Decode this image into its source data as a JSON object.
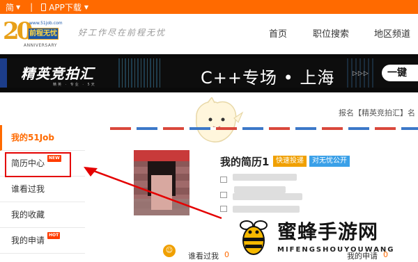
{
  "topbar": {
    "lang": "简",
    "app_download": "APP下载"
  },
  "logo": {
    "url_text": "www.51job.com",
    "badge": "前程无忧",
    "number": "20",
    "anniversary": "ANNIVERSARY"
  },
  "slogan": "好工作尽在前程无忧",
  "nav": [
    {
      "label": "首页"
    },
    {
      "label": "职位搜索"
    },
    {
      "label": "地区频道"
    }
  ],
  "banner": {
    "brand": "精英竞拍汇",
    "brand_sub": "精英 · 专业 · 5天",
    "title": "C++专场 • 上海",
    "arrows": "▷▷▷",
    "cta": "一键"
  },
  "notice": "报名【精英竞拍汇】名",
  "sidebar": {
    "header": "我的51Job",
    "items": [
      {
        "label": "简历中心",
        "tag": "NEW"
      },
      {
        "label": "谁看过我",
        "tag": ""
      },
      {
        "label": "我的收藏",
        "tag": ""
      },
      {
        "label": "我的申请",
        "tag": "HOT"
      }
    ]
  },
  "profile": {
    "resume_name": "我的简历1",
    "quick_apply": "快速投递",
    "open_to_all": "对无忧公开"
  },
  "bottom": {
    "viewed_label": "谁看过我",
    "viewed_count": "0",
    "applied_label": "我的申请",
    "applied_count": "0"
  },
  "watermark": {
    "cn": "蜜蜂手游网",
    "en": "MIFENGSHOUYOUWANG"
  },
  "colors": {
    "brand_orange": "#ff6a00",
    "highlight_red": "#e40000",
    "quick_apply": "#f0a000",
    "open_blue": "#3aa0e8"
  }
}
